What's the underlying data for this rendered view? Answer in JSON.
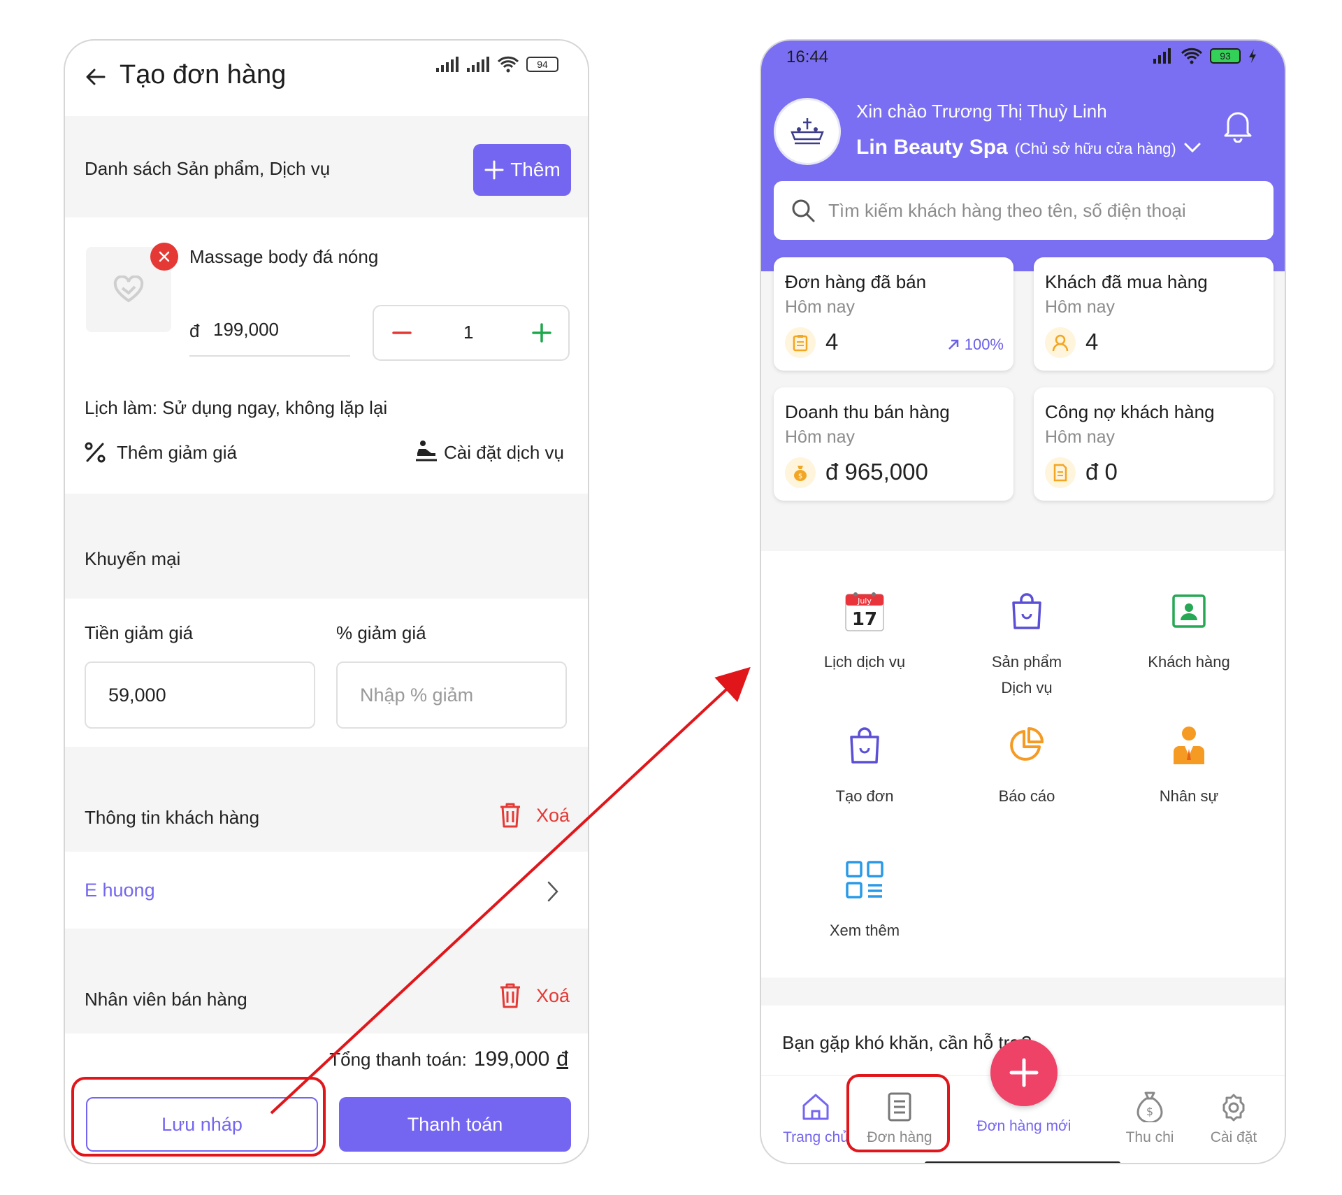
{
  "left_screen": {
    "header": {
      "title": "Tạo đơn hàng",
      "battery": "94"
    },
    "products_section": {
      "title": "Danh sách Sản phẩm, Dịch vụ",
      "add_button": "Thêm"
    },
    "product": {
      "name": "Massage body đá nóng",
      "currency": "đ",
      "price": "199,000",
      "quantity": "1",
      "schedule": "Lịch làm: Sử dụng ngay, không lặp lại",
      "add_discount": "Thêm giảm giá",
      "service_settings": "Cài đặt dịch vụ"
    },
    "promotion": {
      "title": "Khuyến mại",
      "amount_label": "Tiền giảm giá",
      "amount_value": "59,000",
      "percent_label": "% giảm giá",
      "percent_placeholder": "Nhập % giảm"
    },
    "customer": {
      "title": "Thông tin khách hàng",
      "delete": "Xoá",
      "name": "E huong"
    },
    "staff": {
      "title": "Nhân viên bán hàng",
      "delete": "Xoá"
    },
    "total": {
      "label": "Tổng thanh toán:",
      "value": "199,000",
      "currency": "đ"
    },
    "buttons": {
      "draft": "Lưu nháp",
      "pay": "Thanh toán"
    }
  },
  "right_screen": {
    "status": {
      "time": "16:44",
      "battery": "93"
    },
    "greeting": "Xin chào Trương Thị Thuỳ Linh",
    "store_name": "Lin Beauty Spa",
    "store_role": "(Chủ sở hữu cửa hàng)",
    "search_placeholder": "Tìm kiếm khách hàng theo tên, số điện thoại",
    "cards": [
      {
        "title": "Đơn hàng đã bán",
        "period": "Hôm nay",
        "value": "4",
        "change": "100%"
      },
      {
        "title": "Khách đã mua hàng",
        "period": "Hôm nay",
        "value": "4"
      },
      {
        "title": "Doanh thu bán hàng",
        "period": "Hôm nay",
        "value": "đ 965,000"
      },
      {
        "title": "Công nợ khách hàng",
        "period": "Hôm nay",
        "value": "đ 0"
      }
    ],
    "calendar_icon": {
      "month": "July",
      "day": "17"
    },
    "menu": [
      {
        "label": "Lịch dịch vụ",
        "icon": "calendar-icon"
      },
      {
        "label": "Sản phẩm",
        "label2": "Dịch vụ",
        "icon": "shopping-bag-icon"
      },
      {
        "label": "Khách hàng",
        "icon": "contact-card-icon"
      },
      {
        "label": "Tạo đơn",
        "icon": "shopping-bag-icon"
      },
      {
        "label": "Báo cáo",
        "icon": "pie-chart-icon"
      },
      {
        "label": "Nhân sự",
        "icon": "staff-icon"
      },
      {
        "label": "Xem thêm",
        "icon": "grid-icon"
      }
    ],
    "support_text": "Bạn gặp khó khăn, cần hỗ trợ?",
    "nav": [
      {
        "label": "Trang chủ",
        "icon": "home-icon"
      },
      {
        "label": "Đơn hàng",
        "icon": "document-icon"
      },
      {
        "label": "Đơn hàng mới",
        "icon": "plus-icon"
      },
      {
        "label": "Thu chi",
        "icon": "money-bag-icon"
      },
      {
        "label": "Cài đặt",
        "icon": "gear-icon"
      }
    ]
  },
  "colors": {
    "primary": "#7466f0",
    "header_purple": "#7a6ff2",
    "danger": "#e53935",
    "highlight_red": "#e0161b",
    "fab_pink": "#ef4267"
  }
}
